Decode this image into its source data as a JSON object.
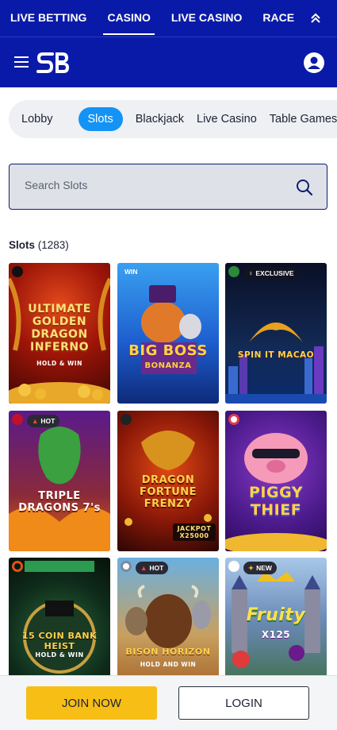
{
  "top_nav": {
    "items": [
      {
        "label": "LIVE BETTING"
      },
      {
        "label": "CASINO",
        "active": true
      },
      {
        "label": "LIVE CASINO"
      },
      {
        "label": "RACEBOOK"
      }
    ],
    "collapse_icon": "double-chevron-up-icon"
  },
  "header": {
    "menu_icon": "hamburger-menu-icon",
    "logo_text": "SB",
    "account_icon": "user-account-icon"
  },
  "category_tabs": [
    {
      "label": "Lobby"
    },
    {
      "label": "Slots",
      "active": true
    },
    {
      "label": "Blackjack"
    },
    {
      "label": "Live Casino"
    },
    {
      "label": "Table Games"
    }
  ],
  "search": {
    "placeholder": "Search Slots",
    "icon": "search-icon"
  },
  "section": {
    "title": "Slots",
    "count": "(1283)"
  },
  "games": [
    {
      "title": "ULTIMATE GOLDEN DRAGON INFERNO",
      "subtitle": "HOLD & WIN"
    },
    {
      "title": "BIG BOSS",
      "subtitle": "BONANZA",
      "provider_text": "WIN"
    },
    {
      "title": "SPIN IT MACAO",
      "badge": "EXCLUSIVE"
    },
    {
      "title": "TRIPLE DRAGONS 7's",
      "badge": "HOT"
    },
    {
      "title": "DRAGON FORTUNE FRENZY",
      "subtitle": "JACKPOT X25000"
    },
    {
      "title": "PIGGY THIEF"
    },
    {
      "title": "15 COIN BANK HEIST",
      "subtitle": "HOLD & WIN"
    },
    {
      "title": "BISON HORIZON",
      "subtitle": "HOLD AND WIN",
      "badge": "HOT"
    },
    {
      "title": "Fruity",
      "subtitle": "X125",
      "badge": "NEW"
    }
  ],
  "footer": {
    "join_label": "JOIN NOW",
    "login_label": "LOGIN"
  },
  "colors": {
    "brand_blue": "#0a1aa8",
    "accent_blue": "#1393f5",
    "join_yellow": "#f7be16"
  }
}
